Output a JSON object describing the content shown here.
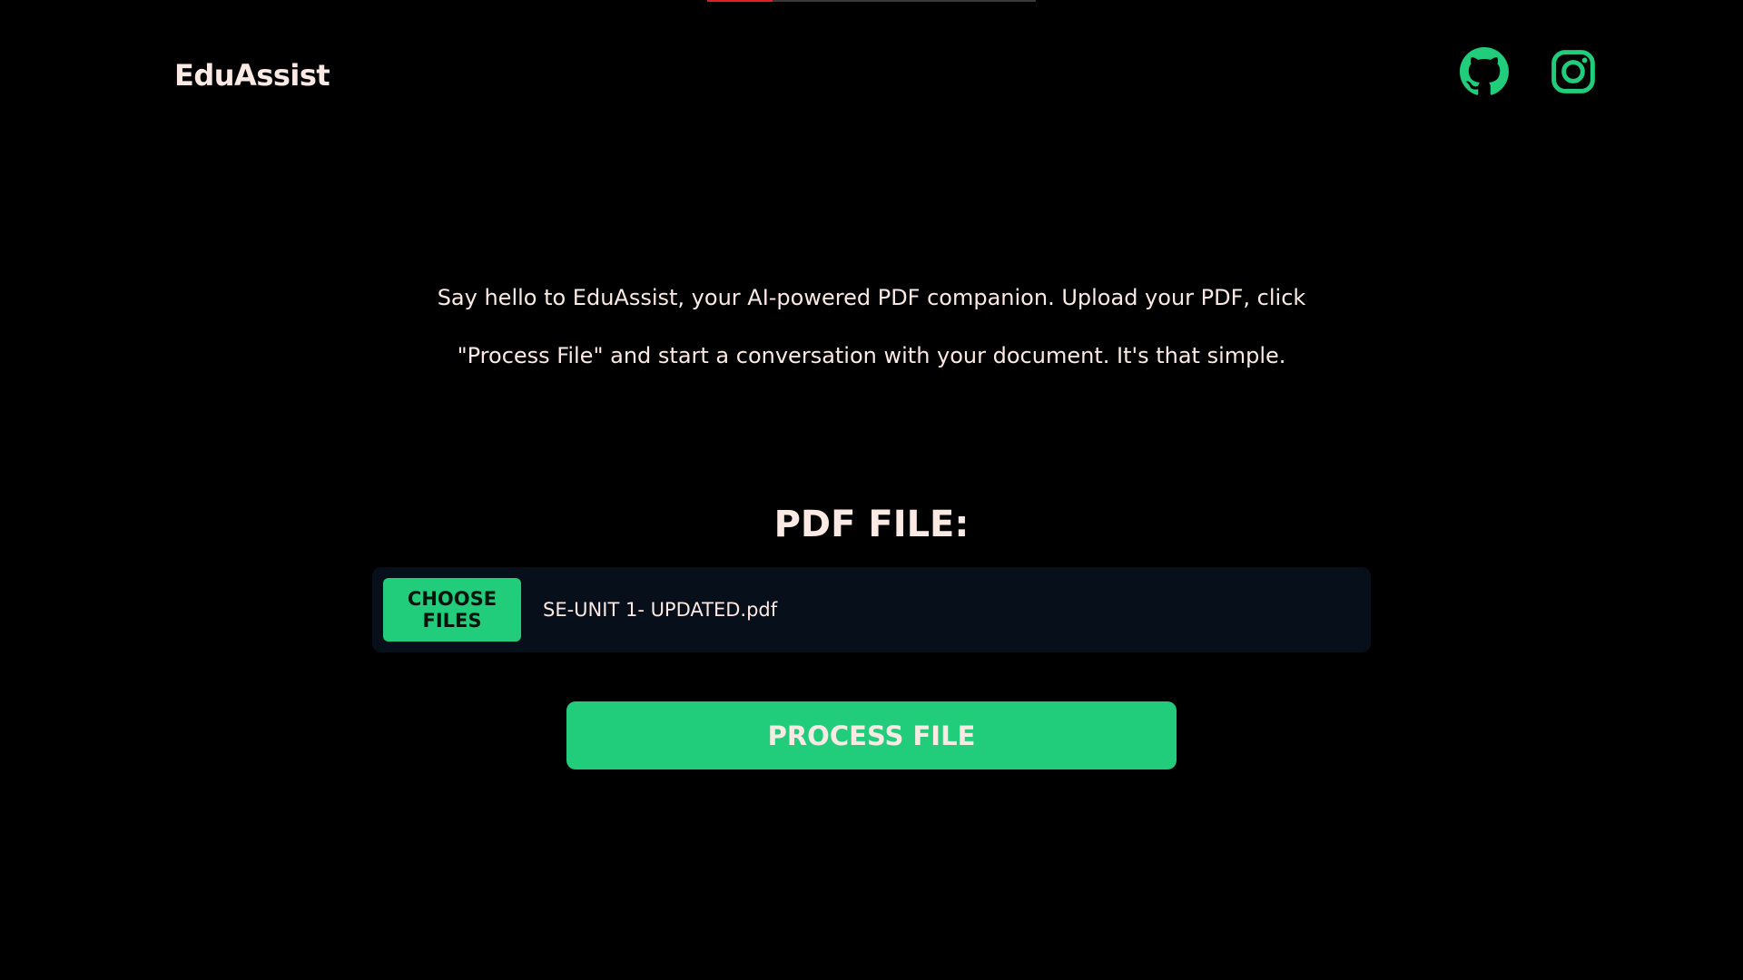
{
  "header": {
    "brand": "EduAssist",
    "links": [
      {
        "icon": "github-icon"
      },
      {
        "icon": "instagram-icon"
      }
    ],
    "progress": 0.2
  },
  "intro": {
    "line1": "Say hello to EduAssist, your AI-powered PDF companion. Upload your PDF, click",
    "line2": "\"Process File\" and start a conversation with your document. It's that simple."
  },
  "upload": {
    "label": "PDF FILE:",
    "choose_button": "CHOOSE FILES",
    "file_name": "SE-UNIT 1- UPDATED.pdf"
  },
  "actions": {
    "process_button": "PROCESS FILE"
  },
  "colors": {
    "accent": "#21cc7b",
    "background": "#000000",
    "text": "#fbe9e4",
    "panel": "#070f1a",
    "progress": "#e11d2a"
  }
}
